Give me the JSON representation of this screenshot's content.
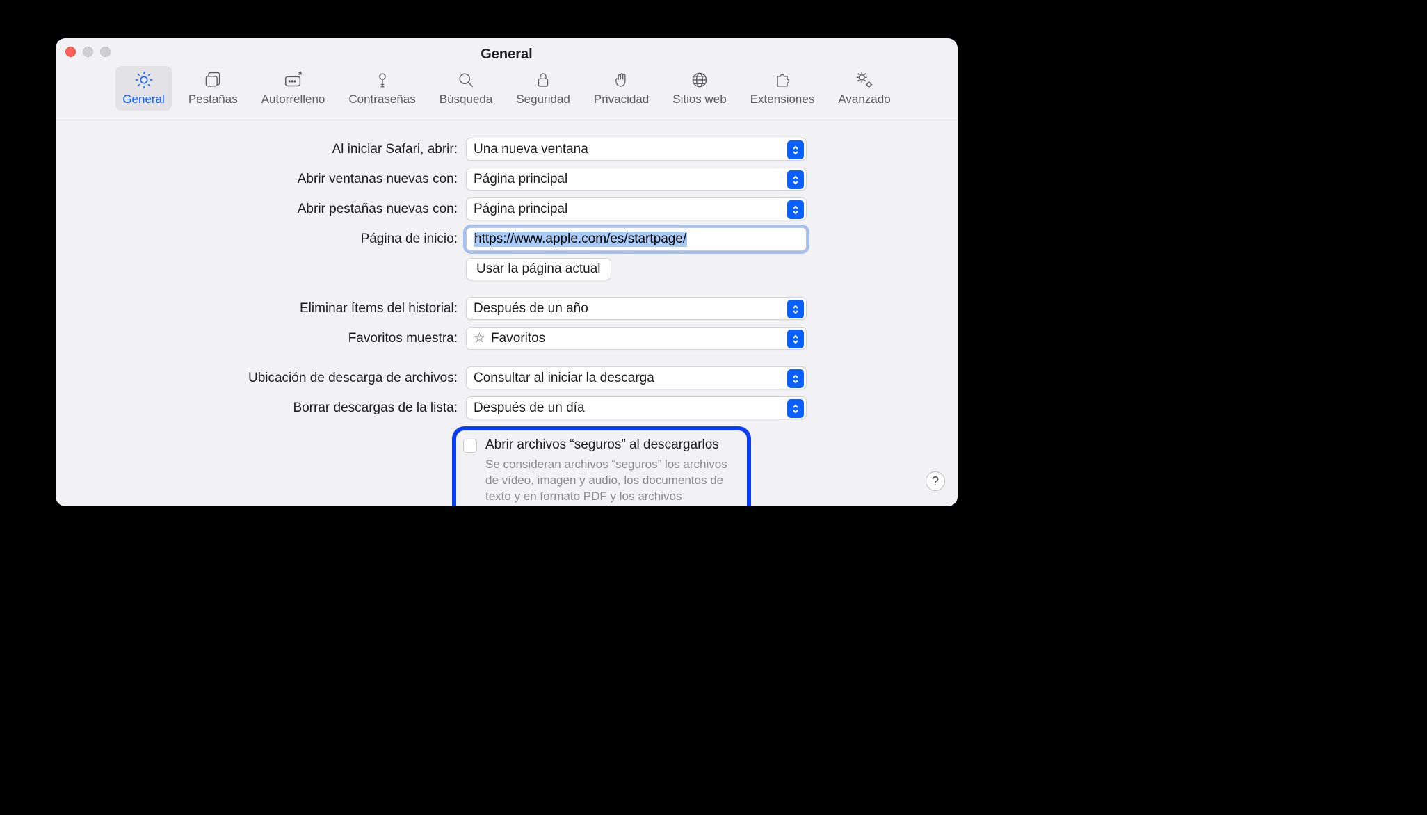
{
  "window": {
    "title": "General"
  },
  "toolbar": {
    "items": [
      {
        "label": "General"
      },
      {
        "label": "Pestañas"
      },
      {
        "label": "Autorrelleno"
      },
      {
        "label": "Contraseñas"
      },
      {
        "label": "Búsqueda"
      },
      {
        "label": "Seguridad"
      },
      {
        "label": "Privacidad"
      },
      {
        "label": "Sitios web"
      },
      {
        "label": "Extensiones"
      },
      {
        "label": "Avanzado"
      }
    ]
  },
  "settings": {
    "on_launch_label": "Al iniciar Safari, abrir:",
    "on_launch_value": "Una nueva ventana",
    "new_windows_label": "Abrir ventanas nuevas con:",
    "new_windows_value": "Página principal",
    "new_tabs_label": "Abrir pestañas nuevas con:",
    "new_tabs_value": "Página principal",
    "homepage_label": "Página de inicio:",
    "homepage_value": "https://www.apple.com/es/startpage/",
    "use_current_button": "Usar la página actual",
    "history_label": "Eliminar ítems del historial:",
    "history_value": "Después de un año",
    "favorites_label": "Favoritos muestra:",
    "favorites_value": "Favoritos",
    "download_loc_label": "Ubicación de descarga de archivos:",
    "download_loc_value": "Consultar al iniciar la descarga",
    "clear_downloads_label": "Borrar descargas de la lista:",
    "clear_downloads_value": "Después de un día",
    "safe_files_label": "Abrir archivos “seguros” al descargarlos",
    "safe_files_desc": "Se consideran archivos “seguros” los archivos de vídeo, imagen y audio, los documentos de texto y en formato PDF y los archivos comprimidos."
  },
  "help_glyph": "?"
}
